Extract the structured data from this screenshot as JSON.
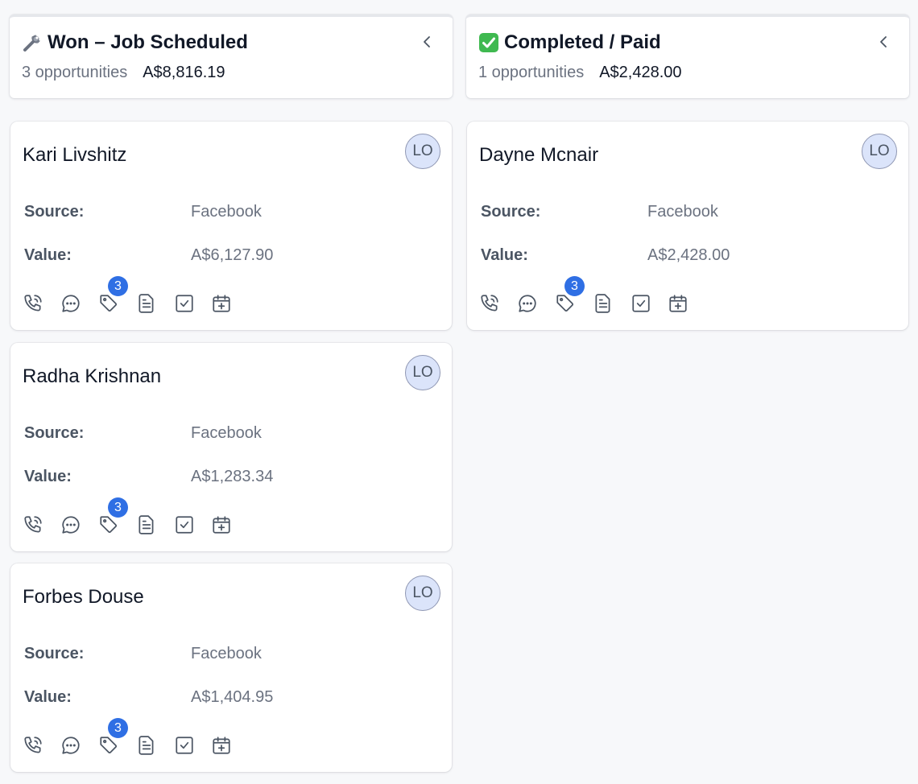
{
  "columns": [
    {
      "title": "Won – Job Scheduled",
      "icon": "wrench-icon",
      "count_text": "3 opportunities",
      "total": "A$8,816.19",
      "cards": [
        {
          "name": "Kari Livshitz",
          "avatar": "LO",
          "source_label": "Source:",
          "source": "Facebook",
          "value_label": "Value:",
          "value": "A$6,127.90",
          "tag_count": "3"
        },
        {
          "name": "Radha Krishnan",
          "avatar": "LO",
          "source_label": "Source:",
          "source": "Facebook",
          "value_label": "Value:",
          "value": "A$1,283.34",
          "tag_count": "3"
        },
        {
          "name": "Forbes Douse",
          "avatar": "LO",
          "source_label": "Source:",
          "source": "Facebook",
          "value_label": "Value:",
          "value": "A$1,404.95",
          "tag_count": "3"
        }
      ]
    },
    {
      "title": "Completed / Paid",
      "icon": "check-mark-button-icon",
      "count_text": "1 opportunities",
      "total": "A$2,428.00",
      "cards": [
        {
          "name": "Dayne Mcnair",
          "avatar": "LO",
          "source_label": "Source:",
          "source": "Facebook",
          "value_label": "Value:",
          "value": "A$2,428.00",
          "tag_count": "3"
        }
      ]
    }
  ],
  "colors": {
    "badge": "#2f6fe4",
    "avatar_bg": "#dbe4fa",
    "check_green": "#3fb950"
  }
}
